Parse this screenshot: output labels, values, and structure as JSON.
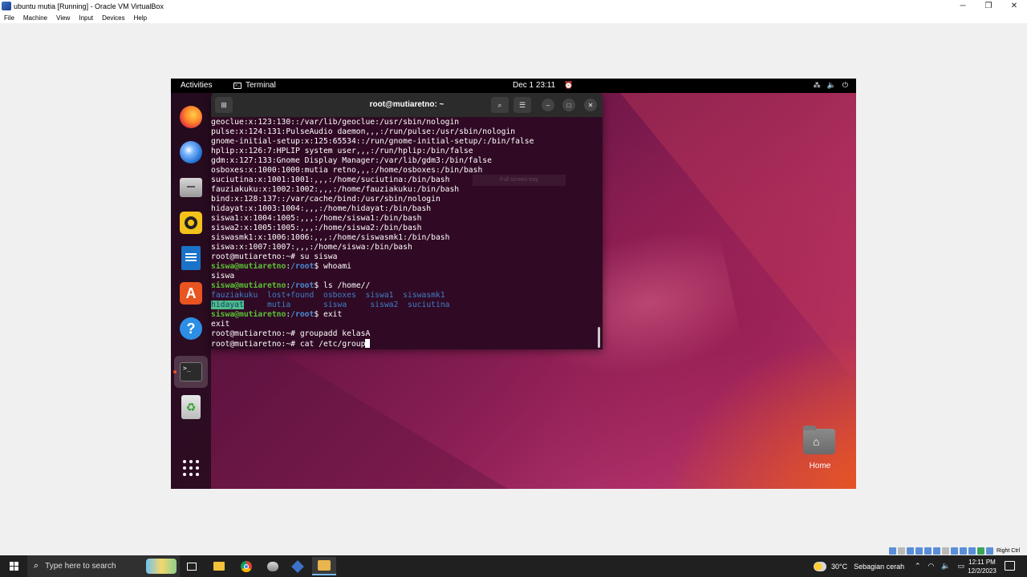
{
  "host_window": {
    "title": "ubuntu mutia [Running] - Oracle VM VirtualBox",
    "controls": {
      "minimize": "─",
      "restore": "❐",
      "close": "✕"
    },
    "menu": [
      "File",
      "Machine",
      "View",
      "Input",
      "Devices",
      "Help"
    ]
  },
  "gnome": {
    "activities": "Activities",
    "app_name": "Terminal",
    "clock": "Dec 1  23:11"
  },
  "terminal": {
    "title": "root@mutiaretno: ~",
    "lines": [
      "geoclue:x:123:130::/var/lib/geoclue:/usr/sbin/nologin",
      "pulse:x:124:131:PulseAudio daemon,,,:/run/pulse:/usr/sbin/nologin",
      "gnome-initial-setup:x:125:65534::/run/gnome-initial-setup/:/bin/false",
      "hplip:x:126:7:HPLIP system user,,,:/run/hplip:/bin/false",
      "gdm:x:127:133:Gnome Display Manager:/var/lib/gdm3:/bin/false",
      "osboxes:x:1000:1000:mutia retno,,,:/home/osboxes:/bin/bash",
      "suciutina:x:1001:1001:,,,:/home/suciutina:/bin/bash",
      "fauziakuku:x:1002:1002:,,,:/home/fauziakuku:/bin/bash",
      "bind:x:128:137::/var/cache/bind:/usr/sbin/nologin",
      "hidayat:x:1003:1004:,,,:/home/hidayat:/bin/bash",
      "siswa1:x:1004:1005:,,,:/home/siswa1:/bin/bash",
      "siswa2:x:1005:1005:,,,:/home/siswa2:/bin/bash",
      "siswasmk1:x:1006:1006:,,,:/home/siswasmk1:/bin/bash",
      "siswa:x:1007:1007:,,,:/home/siswa:/bin/bash",
      "root@mutiaretno:~# su siswa"
    ],
    "prompt_user": "siswa@mutiaretno",
    "prompt_sep": ":",
    "prompt_path": "/root",
    "prompt_end": "$ ",
    "cmd_whoami": "whoami",
    "out_whoami": "siswa",
    "cmd_ls": "ls /home//",
    "ls_row1": [
      "fauziakuku",
      "lost+found",
      "osboxes",
      "siswa1",
      "siswasmk1"
    ],
    "ls_row2": [
      "hidayat",
      "mutia",
      "siswa",
      "siswa2",
      "suciutina"
    ],
    "cmd_exit": "exit",
    "out_exit": "exit",
    "line_groupadd": "root@mutiaretno:~# groupadd kelasA",
    "line_cat": "root@mutiaretno:~# cat /etc/group",
    "ghost_tooltip": "Full screen tray"
  },
  "desktop": {
    "home_label": "Home"
  },
  "taskbar": {
    "search_placeholder": "Type here to search",
    "weather_temp": "30°C",
    "weather_cond": "Sebagian cerah",
    "time": "12:11 PM",
    "date": "12/2/2023"
  },
  "vbox_status": {
    "host_key": "Right Ctrl"
  }
}
